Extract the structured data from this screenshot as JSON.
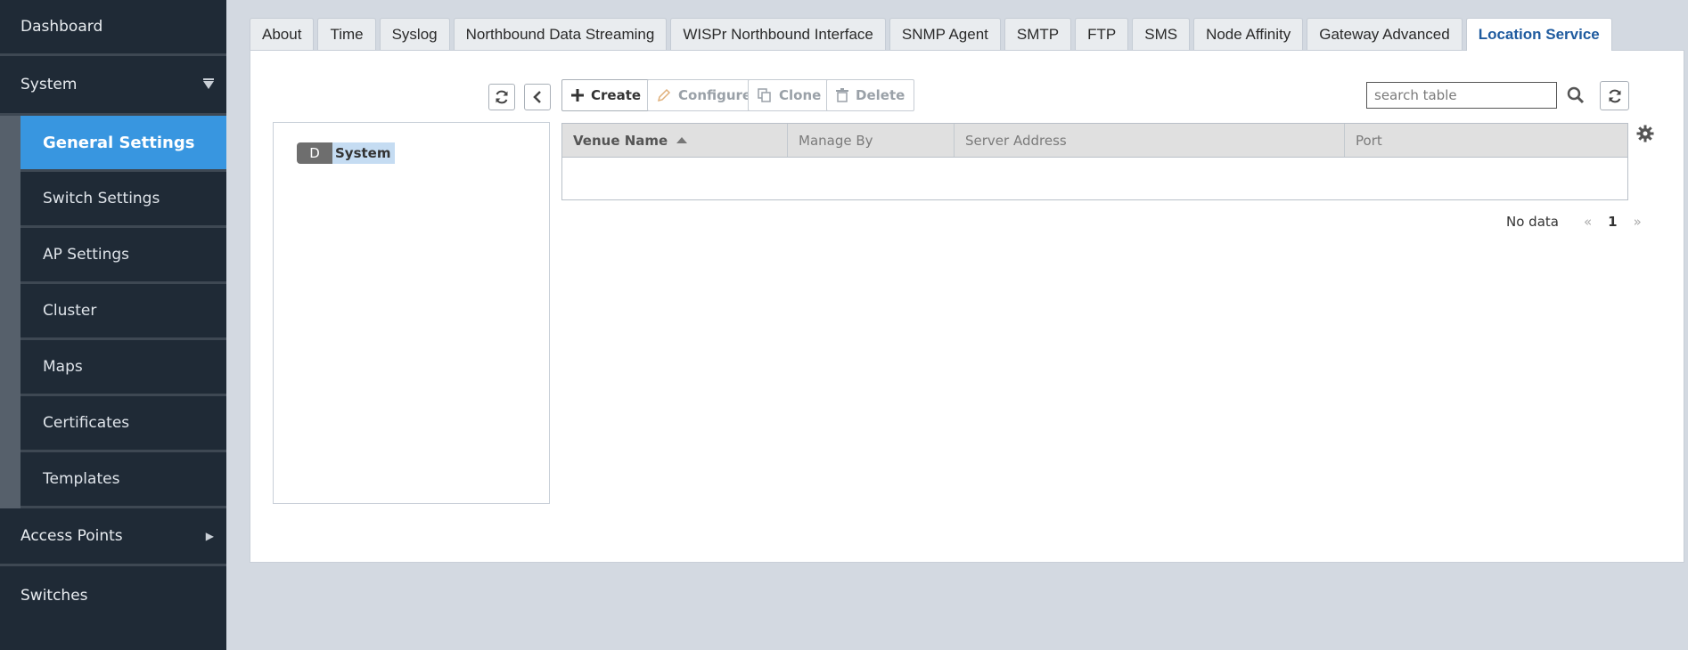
{
  "sidebar": {
    "dashboard": "Dashboard",
    "system": "System",
    "sub_items": [
      {
        "label": "General Settings"
      },
      {
        "label": "Switch Settings"
      },
      {
        "label": "AP Settings"
      },
      {
        "label": "Cluster"
      },
      {
        "label": "Maps"
      },
      {
        "label": "Certificates"
      },
      {
        "label": "Templates"
      }
    ],
    "access_points": "Access Points",
    "switches": "Switches"
  },
  "tabs": [
    {
      "label": "About"
    },
    {
      "label": "Time"
    },
    {
      "label": "Syslog"
    },
    {
      "label": "Northbound Data Streaming"
    },
    {
      "label": "WISPr Northbound Interface"
    },
    {
      "label": "SNMP Agent"
    },
    {
      "label": "SMTP"
    },
    {
      "label": "FTP"
    },
    {
      "label": "SMS"
    },
    {
      "label": "Node Affinity"
    },
    {
      "label": "Gateway Advanced"
    },
    {
      "label": "Location Service"
    }
  ],
  "active_tab": "Location Service",
  "toolbar": {
    "create": "Create",
    "configure": "Configure",
    "clone": "Clone",
    "delete": "Delete",
    "search_placeholder": "search table"
  },
  "tree": {
    "badge": "D",
    "label": "System"
  },
  "table": {
    "columns": [
      {
        "label": "Venue Name",
        "sorted": "asc"
      },
      {
        "label": "Manage By"
      },
      {
        "label": "Server Address"
      },
      {
        "label": "Port"
      }
    ],
    "rows": []
  },
  "pagination": {
    "status": "No data",
    "prev": "«",
    "page": "1",
    "next": "»"
  },
  "colors": {
    "sidebar_bg": "#1f2a36",
    "active_item": "#3896e0",
    "active_tab_text": "#1f5b9f",
    "page_bg": "#d3d9e1"
  }
}
